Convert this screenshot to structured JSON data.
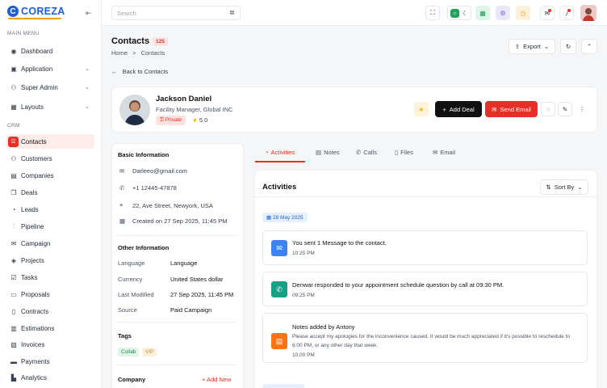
{
  "app": {
    "logo_letter": "C",
    "logo_text": "COREZA"
  },
  "sidebar": {
    "main_menu_label": "MAIN MENU",
    "crm_label": "CRM",
    "main_items": [
      {
        "icon": "dashboard-icon",
        "label": "Dashboard"
      },
      {
        "icon": "application-icon",
        "label": "Application"
      },
      {
        "icon": "super-admin-icon",
        "label": "Super Admin"
      },
      {
        "icon": "layouts-icon",
        "label": "Layouts"
      }
    ],
    "crm_items": [
      {
        "icon": "contacts-icon",
        "label": "Contacts"
      },
      {
        "icon": "customers-icon",
        "label": "Customers"
      },
      {
        "icon": "companies-icon",
        "label": "Companies"
      },
      {
        "icon": "deals-icon",
        "label": "Deals"
      },
      {
        "icon": "leads-icon",
        "label": "Leads"
      },
      {
        "icon": "pipeline-icon",
        "label": "Pipeline"
      },
      {
        "icon": "campaign-icon",
        "label": "Campaign"
      },
      {
        "icon": "projects-icon",
        "label": "Projects"
      },
      {
        "icon": "tasks-icon",
        "label": "Tasks"
      },
      {
        "icon": "proposals-icon",
        "label": "Proposals"
      },
      {
        "icon": "contracts-icon",
        "label": "Contracts"
      },
      {
        "icon": "estimations-icon",
        "label": "Estimations"
      },
      {
        "icon": "invoices-icon",
        "label": "Invoices"
      },
      {
        "icon": "payments-icon",
        "label": "Payments"
      },
      {
        "icon": "analytics-icon",
        "label": "Analytics"
      }
    ]
  },
  "search": {
    "placeholder": "Search",
    "shortcut": "⌘"
  },
  "page": {
    "title": "Contacts",
    "count": "125",
    "breadcrumb_home": "Home",
    "breadcrumb_sep": ">",
    "breadcrumb_current": "Contacts",
    "export_label": "Export",
    "back_label": "Back to Contacts"
  },
  "profile": {
    "name": "Jackson Daniel",
    "role": "Facility Manager, Global INC",
    "privacy": "Private",
    "rating": "5.0",
    "add_deal_label": "Add Deal",
    "send_email_label": "Send Email"
  },
  "basic_info": {
    "title": "Basic Information",
    "email": "Darleeo@gmail.com",
    "phone": "+1 12445-47878",
    "address": "22, Ave Street, Newyork, USA",
    "created": "Created on 27 Sep 2025, 11:45 PM"
  },
  "other_info": {
    "title": "Other Information",
    "rows": [
      {
        "label": "Language",
        "value": "Language"
      },
      {
        "label": "Currency",
        "value": "United States dollar"
      },
      {
        "label": "Last Modified",
        "value": "27 Sep 2025, 11:45 PM"
      },
      {
        "label": "Source",
        "value": "Paid Campaign"
      }
    ]
  },
  "tags": {
    "title": "Tags",
    "items": [
      "Collab",
      "VIP"
    ]
  },
  "company": {
    "title": "Company",
    "add_label": "Add New"
  },
  "tabs": [
    {
      "icon": "activities-icon",
      "label": "Activities"
    },
    {
      "icon": "notes-icon",
      "label": "Notes"
    },
    {
      "icon": "calls-icon",
      "label": "Calls"
    },
    {
      "icon": "files-icon",
      "label": "Files"
    },
    {
      "icon": "email-icon",
      "label": "Email"
    }
  ],
  "activities": {
    "title": "Activities",
    "sort_label": "Sort By",
    "date": "28 May 2025",
    "items": [
      {
        "icon": "message-icon",
        "text": "You sent 1 Message to the contact.",
        "time": "10:25 PM",
        "color": "#3b82f6"
      },
      {
        "icon": "phone-icon",
        "text": "Denwar responded to your appointment schedule question by call at 09:30 PM.",
        "time": "09:25 PM",
        "color": "#16a085"
      },
      {
        "icon": "note-icon",
        "text": "Notes added by Antony",
        "note": "Please accept my apologies for the inconvenience caused. It would be much appreciated if it's possible to reschedule to 6:00 PM, or any other day that week.",
        "time": "10.00 PM",
        "color": "#f97316"
      }
    ]
  },
  "colors": {
    "accent": "#e63027",
    "brand": "#1e5fd6"
  }
}
